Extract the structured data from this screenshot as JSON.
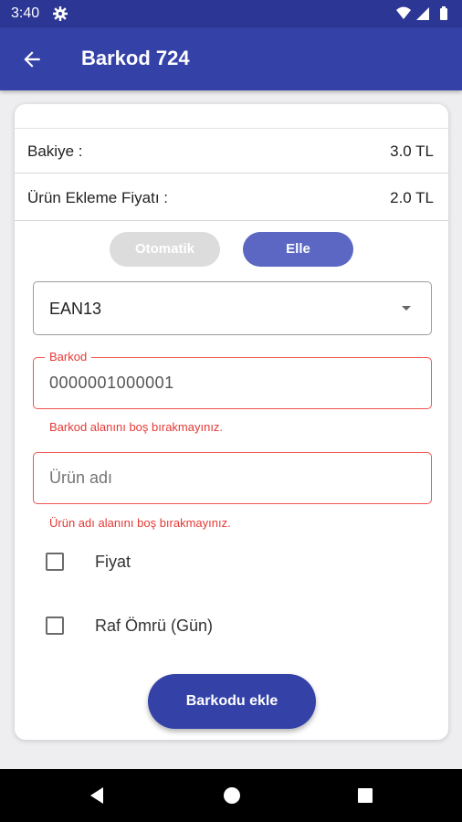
{
  "status_bar": {
    "time": "3:40"
  },
  "app_bar": {
    "title": "Barkod 724"
  },
  "balance": {
    "label": "Bakiye :",
    "value": "3.0 TL"
  },
  "product_fee": {
    "label": "Ürün Ekleme Fiyatı :",
    "value": "2.0 TL"
  },
  "mode_toggle": {
    "auto_label": "Otomatik",
    "manual_label": "Elle",
    "selected": "Elle"
  },
  "barcode_type": {
    "selected": "EAN13"
  },
  "barcode_field": {
    "label": "Barkod",
    "value": "0000001000001",
    "error": "Barkod alanını boş bırakmayınız."
  },
  "product_name_field": {
    "placeholder": "Ürün adı",
    "error": "Ürün adı alanını boş bırakmayınız."
  },
  "options": [
    {
      "label": "Fiyat",
      "checked": false
    },
    {
      "label": "Raf Ömrü (Gün)",
      "checked": false
    }
  ],
  "submit": {
    "label": "Barkodu ekle"
  },
  "colors": {
    "primary": "#3442a8",
    "status_bar": "#2c3694",
    "error": "#e53935",
    "toggle_active": "#5b67c2",
    "toggle_inactive": "#dcdcdc"
  },
  "icons": {
    "back": "arrow-left-icon",
    "settings": "gear-icon",
    "nav_back": "triangle-back-icon",
    "nav_home": "circle-home-icon",
    "nav_recent": "square-recents-icon"
  }
}
